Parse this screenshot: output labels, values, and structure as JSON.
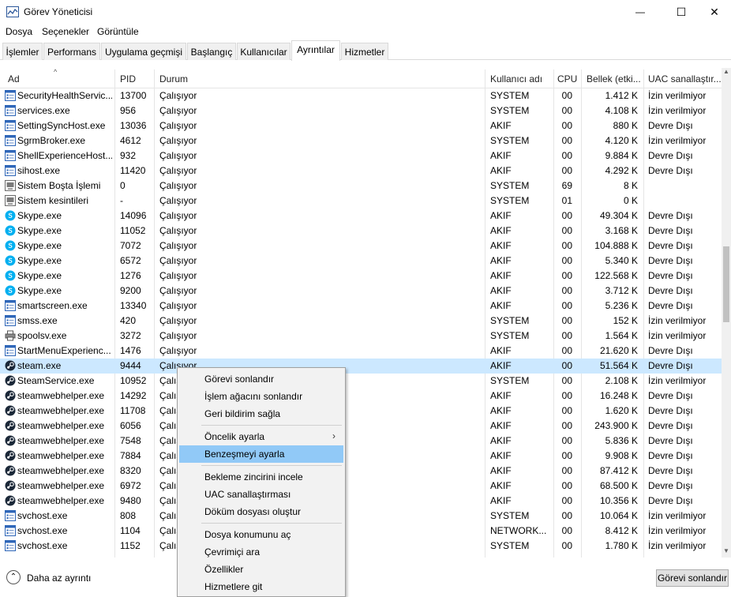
{
  "window": {
    "title": "Görev Yöneticisi",
    "minimize_glyph": "—",
    "maximize_glyph": "☐",
    "close_glyph": "✕"
  },
  "menu": [
    "Dosya",
    "Seçenekler",
    "Görüntüle"
  ],
  "tabs": [
    {
      "label": "İşlemler"
    },
    {
      "label": "Performans"
    },
    {
      "label": "Uygulama geçmişi"
    },
    {
      "label": "Başlangıç"
    },
    {
      "label": "Kullanıcılar"
    },
    {
      "label": "Ayrıntılar",
      "active": true
    },
    {
      "label": "Hizmetler"
    }
  ],
  "table": {
    "columns": [
      "Ad",
      "PID",
      "Durum",
      "Kullanıcı adı",
      "CPU",
      "Bellek (etki...",
      "UAC sanallaştır..."
    ],
    "sort_arrow": "^",
    "rows": [
      {
        "name": "SecurityHealthServic...",
        "pid": "13700",
        "status": "Çalışıyor",
        "user": "SYSTEM",
        "cpu": "00",
        "mem": "1.412 K",
        "uac": "İzin verilmiyor",
        "icon": "generic-icon"
      },
      {
        "name": "services.exe",
        "pid": "956",
        "status": "Çalışıyor",
        "user": "SYSTEM",
        "cpu": "00",
        "mem": "4.108 K",
        "uac": "İzin verilmiyor",
        "icon": "generic-icon"
      },
      {
        "name": "SettingSyncHost.exe",
        "pid": "13036",
        "status": "Çalışıyor",
        "user": "AKIF",
        "cpu": "00",
        "mem": "880 K",
        "uac": "Devre Dışı",
        "icon": "generic-icon"
      },
      {
        "name": "SgrmBroker.exe",
        "pid": "4612",
        "status": "Çalışıyor",
        "user": "SYSTEM",
        "cpu": "00",
        "mem": "4.120 K",
        "uac": "İzin verilmiyor",
        "icon": "generic-icon"
      },
      {
        "name": "ShellExperienceHost...",
        "pid": "932",
        "status": "Çalışıyor",
        "user": "AKIF",
        "cpu": "00",
        "mem": "9.884 K",
        "uac": "Devre Dışı",
        "icon": "generic-icon"
      },
      {
        "name": "sihost.exe",
        "pid": "11420",
        "status": "Çalışıyor",
        "user": "AKIF",
        "cpu": "00",
        "mem": "4.292 K",
        "uac": "Devre Dışı",
        "icon": "generic-icon"
      },
      {
        "name": "Sistem Boşta İşlemi",
        "pid": "0",
        "status": "Çalışıyor",
        "user": "SYSTEM",
        "cpu": "69",
        "mem": "8 K",
        "uac": "",
        "icon": "system-icon"
      },
      {
        "name": "Sistem kesintileri",
        "pid": "-",
        "status": "Çalışıyor",
        "user": "SYSTEM",
        "cpu": "01",
        "mem": "0 K",
        "uac": "",
        "icon": "system-icon"
      },
      {
        "name": "Skype.exe",
        "pid": "14096",
        "status": "Çalışıyor",
        "user": "AKIF",
        "cpu": "00",
        "mem": "49.304 K",
        "uac": "Devre Dışı",
        "icon": "skype-icon"
      },
      {
        "name": "Skype.exe",
        "pid": "11052",
        "status": "Çalışıyor",
        "user": "AKIF",
        "cpu": "00",
        "mem": "3.168 K",
        "uac": "Devre Dışı",
        "icon": "skype-icon"
      },
      {
        "name": "Skype.exe",
        "pid": "7072",
        "status": "Çalışıyor",
        "user": "AKIF",
        "cpu": "00",
        "mem": "104.888 K",
        "uac": "Devre Dışı",
        "icon": "skype-icon"
      },
      {
        "name": "Skype.exe",
        "pid": "6572",
        "status": "Çalışıyor",
        "user": "AKIF",
        "cpu": "00",
        "mem": "5.340 K",
        "uac": "Devre Dışı",
        "icon": "skype-icon"
      },
      {
        "name": "Skype.exe",
        "pid": "1276",
        "status": "Çalışıyor",
        "user": "AKIF",
        "cpu": "00",
        "mem": "122.568 K",
        "uac": "Devre Dışı",
        "icon": "skype-icon"
      },
      {
        "name": "Skype.exe",
        "pid": "9200",
        "status": "Çalışıyor",
        "user": "AKIF",
        "cpu": "00",
        "mem": "3.712 K",
        "uac": "Devre Dışı",
        "icon": "skype-icon"
      },
      {
        "name": "smartscreen.exe",
        "pid": "13340",
        "status": "Çalışıyor",
        "user": "AKIF",
        "cpu": "00",
        "mem": "5.236 K",
        "uac": "Devre Dışı",
        "icon": "generic-icon"
      },
      {
        "name": "smss.exe",
        "pid": "420",
        "status": "Çalışıyor",
        "user": "SYSTEM",
        "cpu": "00",
        "mem": "152 K",
        "uac": "İzin verilmiyor",
        "icon": "generic-icon"
      },
      {
        "name": "spoolsv.exe",
        "pid": "3272",
        "status": "Çalışıyor",
        "user": "SYSTEM",
        "cpu": "00",
        "mem": "1.564 K",
        "uac": "İzin verilmiyor",
        "icon": "printer-icon"
      },
      {
        "name": "StartMenuExperienc...",
        "pid": "1476",
        "status": "Çalışıyor",
        "user": "AKIF",
        "cpu": "00",
        "mem": "21.620 K",
        "uac": "Devre Dışı",
        "icon": "generic-icon"
      },
      {
        "name": "steam.exe",
        "pid": "9444",
        "status": "Çalışıyor",
        "user": "AKIF",
        "cpu": "00",
        "mem": "51.564 K",
        "uac": "Devre Dışı",
        "icon": "steam-icon",
        "selected": true
      },
      {
        "name": "SteamService.exe",
        "pid": "10952",
        "status": "Çalışıyor",
        "user": "SYSTEM",
        "cpu": "00",
        "mem": "2.108 K",
        "uac": "İzin verilmiyor",
        "icon": "steam-icon"
      },
      {
        "name": "steamwebhelper.exe",
        "pid": "14292",
        "status": "Çalışıyor",
        "user": "AKIF",
        "cpu": "00",
        "mem": "16.248 K",
        "uac": "Devre Dışı",
        "icon": "steam-icon"
      },
      {
        "name": "steamwebhelper.exe",
        "pid": "11708",
        "status": "Çalışıyor",
        "user": "AKIF",
        "cpu": "00",
        "mem": "1.620 K",
        "uac": "Devre Dışı",
        "icon": "steam-icon"
      },
      {
        "name": "steamwebhelper.exe",
        "pid": "6056",
        "status": "Çalışıyor",
        "user": "AKIF",
        "cpu": "00",
        "mem": "243.900 K",
        "uac": "Devre Dışı",
        "icon": "steam-icon"
      },
      {
        "name": "steamwebhelper.exe",
        "pid": "7548",
        "status": "Çalışıyor",
        "user": "AKIF",
        "cpu": "00",
        "mem": "5.836 K",
        "uac": "Devre Dışı",
        "icon": "steam-icon"
      },
      {
        "name": "steamwebhelper.exe",
        "pid": "7884",
        "status": "Çalışıyor",
        "user": "AKIF",
        "cpu": "00",
        "mem": "9.908 K",
        "uac": "Devre Dışı",
        "icon": "steam-icon"
      },
      {
        "name": "steamwebhelper.exe",
        "pid": "8320",
        "status": "Çalışıyor",
        "user": "AKIF",
        "cpu": "00",
        "mem": "87.412 K",
        "uac": "Devre Dışı",
        "icon": "steam-icon"
      },
      {
        "name": "steamwebhelper.exe",
        "pid": "6972",
        "status": "Çalışıyor",
        "user": "AKIF",
        "cpu": "00",
        "mem": "68.500 K",
        "uac": "Devre Dışı",
        "icon": "steam-icon"
      },
      {
        "name": "steamwebhelper.exe",
        "pid": "9480",
        "status": "Çalışıyor",
        "user": "AKIF",
        "cpu": "00",
        "mem": "10.356 K",
        "uac": "Devre Dışı",
        "icon": "steam-icon"
      },
      {
        "name": "svchost.exe",
        "pid": "808",
        "status": "Çalışıyor",
        "user": "SYSTEM",
        "cpu": "00",
        "mem": "10.064 K",
        "uac": "İzin verilmiyor",
        "icon": "generic-icon"
      },
      {
        "name": "svchost.exe",
        "pid": "1104",
        "status": "Çalışıyor",
        "user": "NETWORK...",
        "cpu": "00",
        "mem": "8.412 K",
        "uac": "İzin verilmiyor",
        "icon": "generic-icon"
      },
      {
        "name": "svchost.exe",
        "pid": "1152",
        "status": "Çalışıyor",
        "user": "SYSTEM",
        "cpu": "00",
        "mem": "1.780 K",
        "uac": "İzin verilmiyor",
        "icon": "generic-icon"
      }
    ]
  },
  "context_menu": {
    "items": [
      {
        "label": "Görevi sonlandır"
      },
      {
        "label": "İşlem ağacını sonlandır"
      },
      {
        "label": "Geri bildirim sağla"
      },
      {
        "separator": true
      },
      {
        "label": "Öncelik ayarla",
        "submenu": true
      },
      {
        "label": "Benzeşmeyi ayarla",
        "highlighted": true
      },
      {
        "separator": true
      },
      {
        "label": "Bekleme zincirini incele"
      },
      {
        "label": "UAC sanallaştırması"
      },
      {
        "label": "Döküm dosyası oluştur"
      },
      {
        "separator": true
      },
      {
        "label": "Dosya konumunu aç"
      },
      {
        "label": "Çevrimiçi ara"
      },
      {
        "label": "Özellikler"
      },
      {
        "label": "Hizmetlere git"
      }
    ],
    "submenu_glyph": "›"
  },
  "footer": {
    "less_details": "Daha az ayrıntı",
    "less_details_glyph": "⌃",
    "end_task": "Görevi sonlandır"
  },
  "scrollbar": {
    "up_glyph": "▲",
    "down_glyph": "▼"
  },
  "colors": {
    "selected_row": "#cce8ff",
    "menu_highlight": "#91c9f7",
    "skype": "#00aff0",
    "steam": "#1b2838"
  }
}
